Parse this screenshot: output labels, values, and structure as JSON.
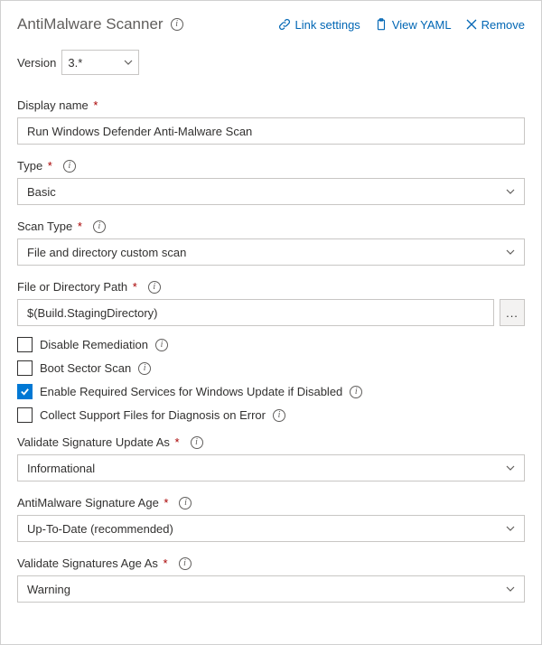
{
  "header": {
    "title": "AntiMalware Scanner",
    "links": {
      "link_settings": "Link settings",
      "view_yaml": "View YAML",
      "remove": "Remove"
    }
  },
  "version": {
    "label": "Version",
    "value": "3.*"
  },
  "fields": {
    "display_name": {
      "label": "Display name",
      "value": "Run Windows Defender Anti-Malware Scan"
    },
    "type": {
      "label": "Type",
      "value": "Basic"
    },
    "scan_type": {
      "label": "Scan Type",
      "value": "File and directory custom scan"
    },
    "path": {
      "label": "File or Directory Path",
      "value": "$(Build.StagingDirectory)"
    },
    "checkboxes": {
      "disable_remediation": {
        "label": "Disable Remediation",
        "checked": false
      },
      "boot_sector": {
        "label": "Boot Sector Scan",
        "checked": false
      },
      "enable_services": {
        "label": "Enable Required Services for Windows Update if Disabled",
        "checked": true
      },
      "collect_support": {
        "label": "Collect Support Files for Diagnosis on Error",
        "checked": false
      }
    },
    "validate_sig_update": {
      "label": "Validate Signature Update As",
      "value": "Informational"
    },
    "sig_age": {
      "label": "AntiMalware Signature Age",
      "value": "Up-To-Date (recommended)"
    },
    "validate_sig_age": {
      "label": "Validate Signatures Age As",
      "value": "Warning"
    }
  }
}
